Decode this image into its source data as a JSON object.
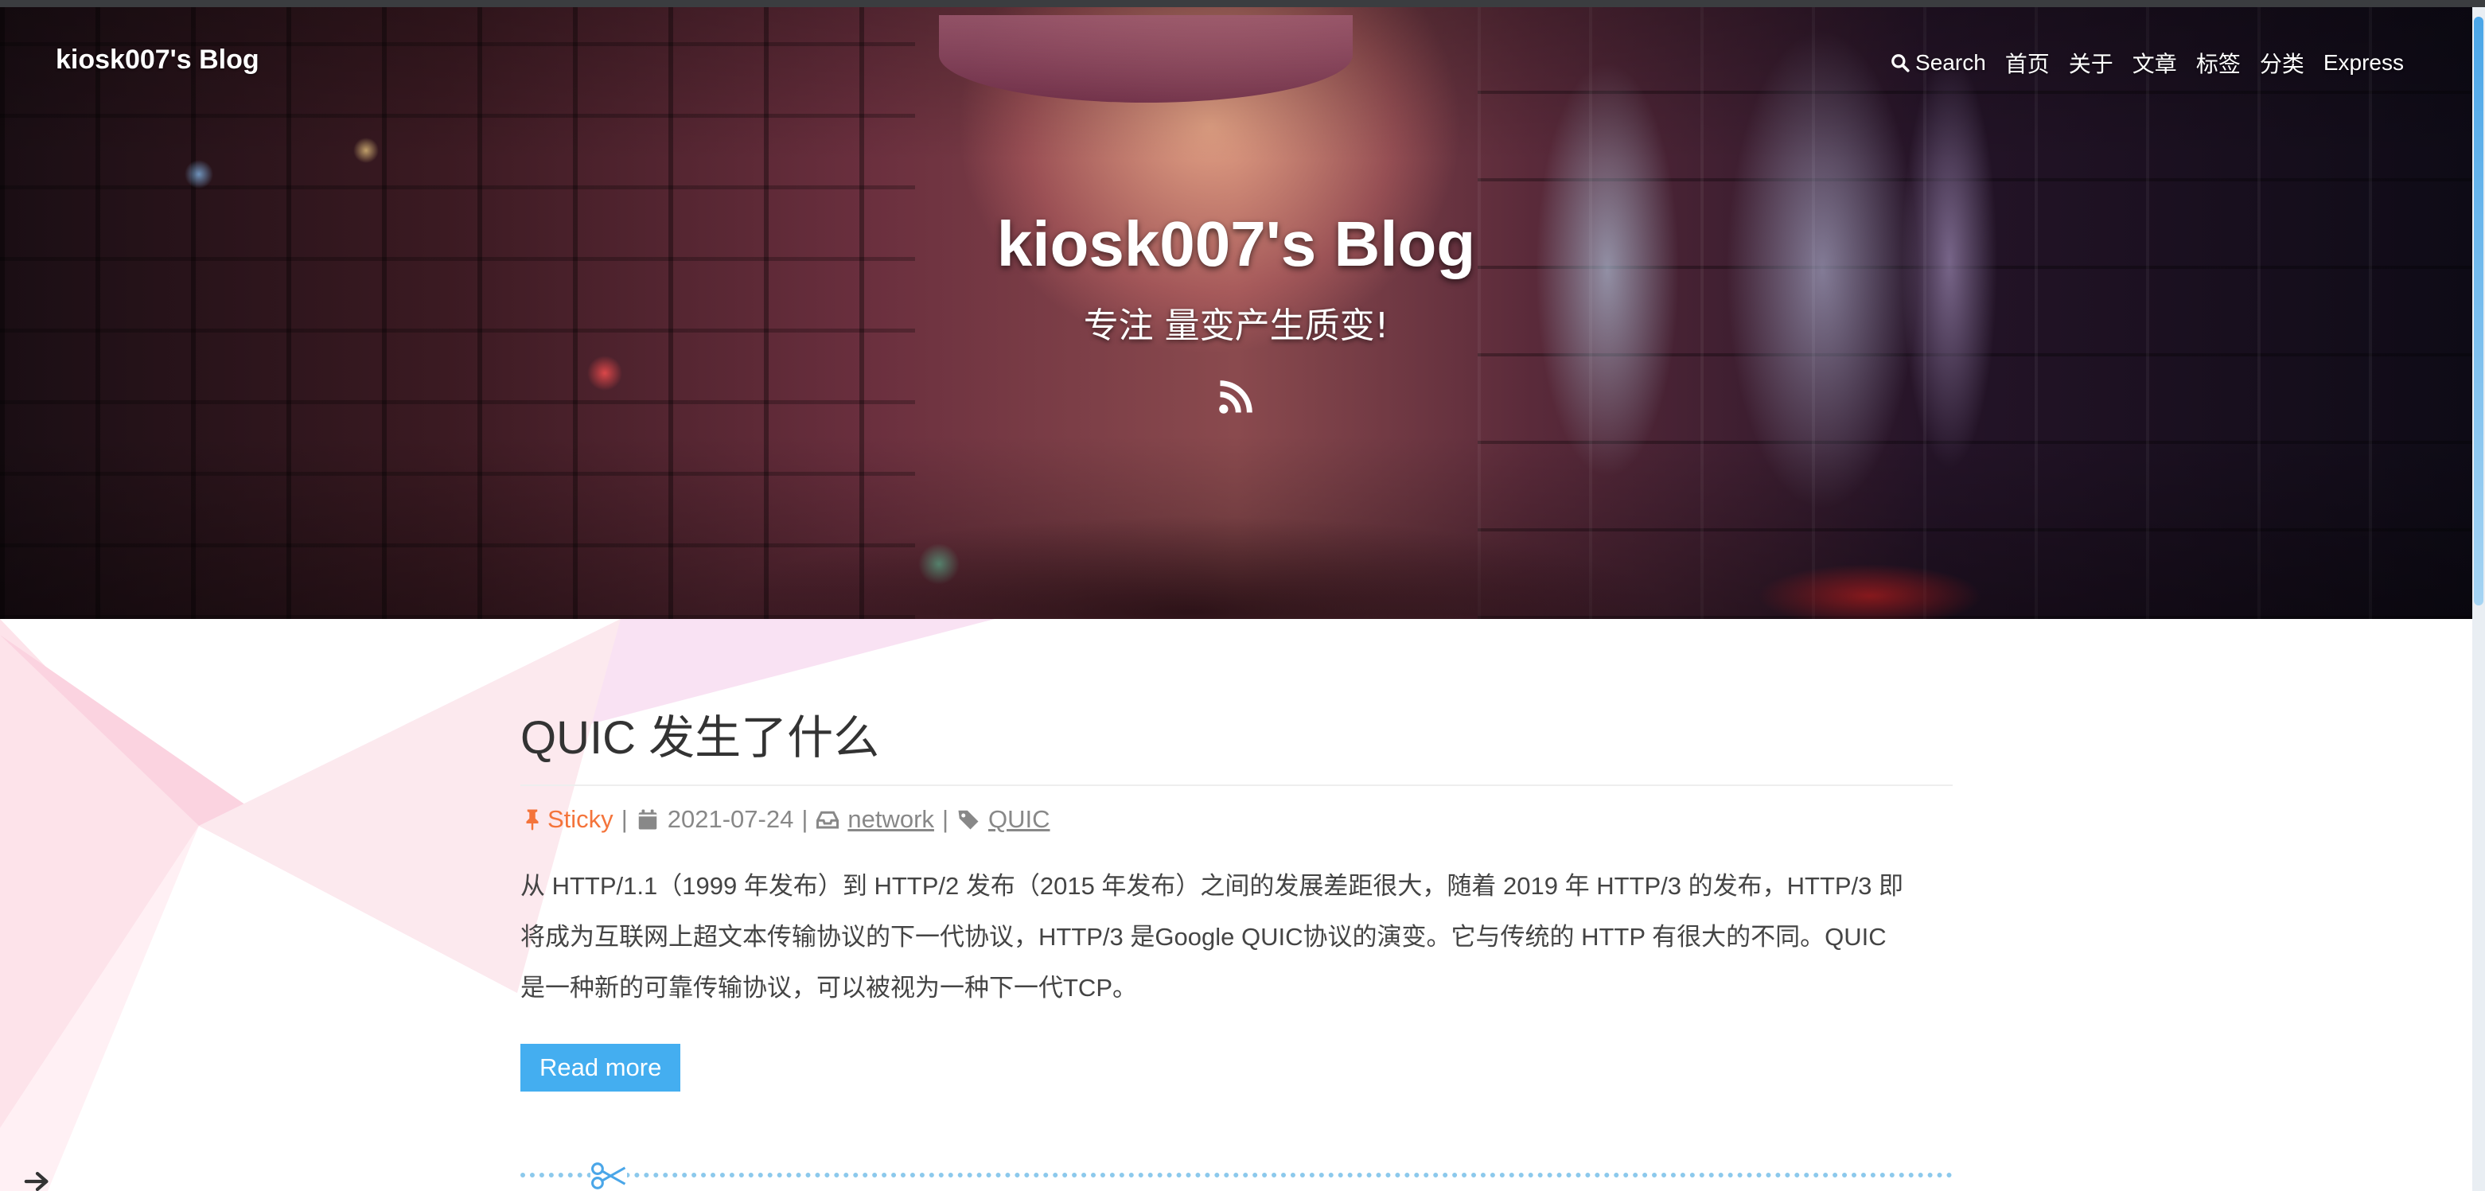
{
  "site": {
    "brand": "kiosk007's Blog",
    "hero_title": "kiosk007's Blog",
    "hero_subtitle": "专注 量变产生质变!"
  },
  "nav": {
    "items": [
      {
        "label": "Search",
        "icon": "search-icon"
      },
      {
        "label": "首页"
      },
      {
        "label": "关于"
      },
      {
        "label": "文章"
      },
      {
        "label": "标签"
      },
      {
        "label": "分类"
      },
      {
        "label": "Express"
      }
    ]
  },
  "post": {
    "title": "QUIC 发生了什么",
    "sticky_label": "Sticky",
    "date": "2021-07-24",
    "category": "network",
    "tag": "QUIC",
    "separator": "|",
    "excerpt_lines": [
      "从 HTTP/1.1（1999 年发布）到 HTTP/2 发布（2015 年发布）之间的发展差距很大，随着 2019 年 HTTP/3 的发布，HTTP/3 即",
      "将成为互联网上超文本传输协议的下一代协议，HTTP/3 是Google QUIC协议的演变。它与传统的 HTTP 有很大的不同。QUIC",
      "是一种新的可靠传输协议，可以被视为一种下一代TCP。"
    ],
    "read_more_label": "Read more"
  },
  "colors": {
    "accent": "#44aef0",
    "sticky": "#f4743b",
    "meta": "#888888",
    "divider": "#8cc9ec"
  }
}
